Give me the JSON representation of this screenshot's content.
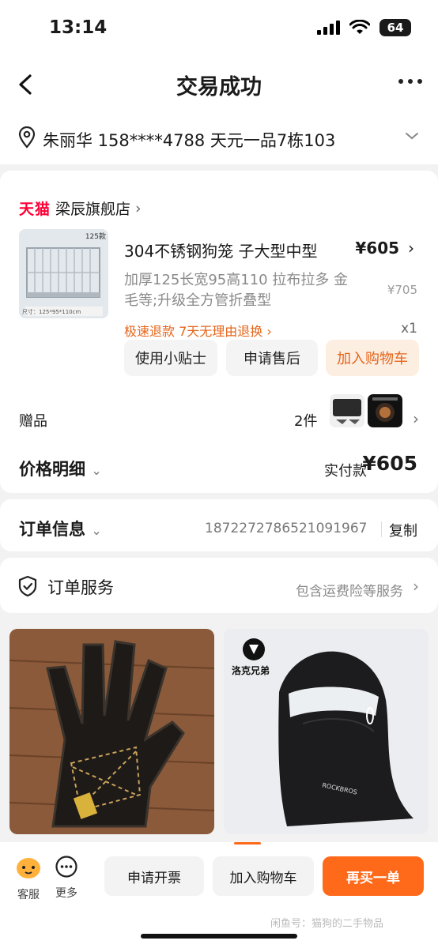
{
  "status": {
    "time": "13:14",
    "battery": "64"
  },
  "nav": {
    "title": "交易成功"
  },
  "address": {
    "text": "朱丽华  158****4788  天元一品7栋103"
  },
  "shop": {
    "logo": "天猫",
    "name": "梁辰旗舰店"
  },
  "product": {
    "title": "304不锈钢狗笼 子大型中型",
    "price": "¥605",
    "desc": "加厚125长宽95高110 拉布拉多 金毛等;升级全方管折叠型",
    "orig_price": "¥705",
    "promo": "极速退款  7天无理由退换",
    "qty": "x1",
    "img_tag": "125款",
    "img_caption": "尺寸：125*95*110cm"
  },
  "buttons": {
    "tips": "使用小贴士",
    "after_sale": "申请售后",
    "add_cart": "加入购物车"
  },
  "gift": {
    "label": "赠品",
    "count": "2件"
  },
  "price_detail": {
    "label": "价格明细",
    "pay_label": "实付款",
    "pay_value": "¥605"
  },
  "order_info": {
    "label": "订单信息",
    "number": "1872272786521091967",
    "copy": "复制"
  },
  "order_service": {
    "label": "订单服务",
    "desc": "包含运费险等服务"
  },
  "recommend": {
    "brand": "洛克兄弟",
    "mask_text": "ROCKBROS"
  },
  "bottom": {
    "service": "客服",
    "more": "更多",
    "invoice": "申请开票",
    "add_cart": "加入购物车",
    "buy_again": "再买一单",
    "watermark": "闲鱼号：猫狗的二手物品"
  },
  "colors": {
    "accent": "#ff6a1a",
    "tmall": "#ff0036",
    "promo": "#e5651a"
  }
}
